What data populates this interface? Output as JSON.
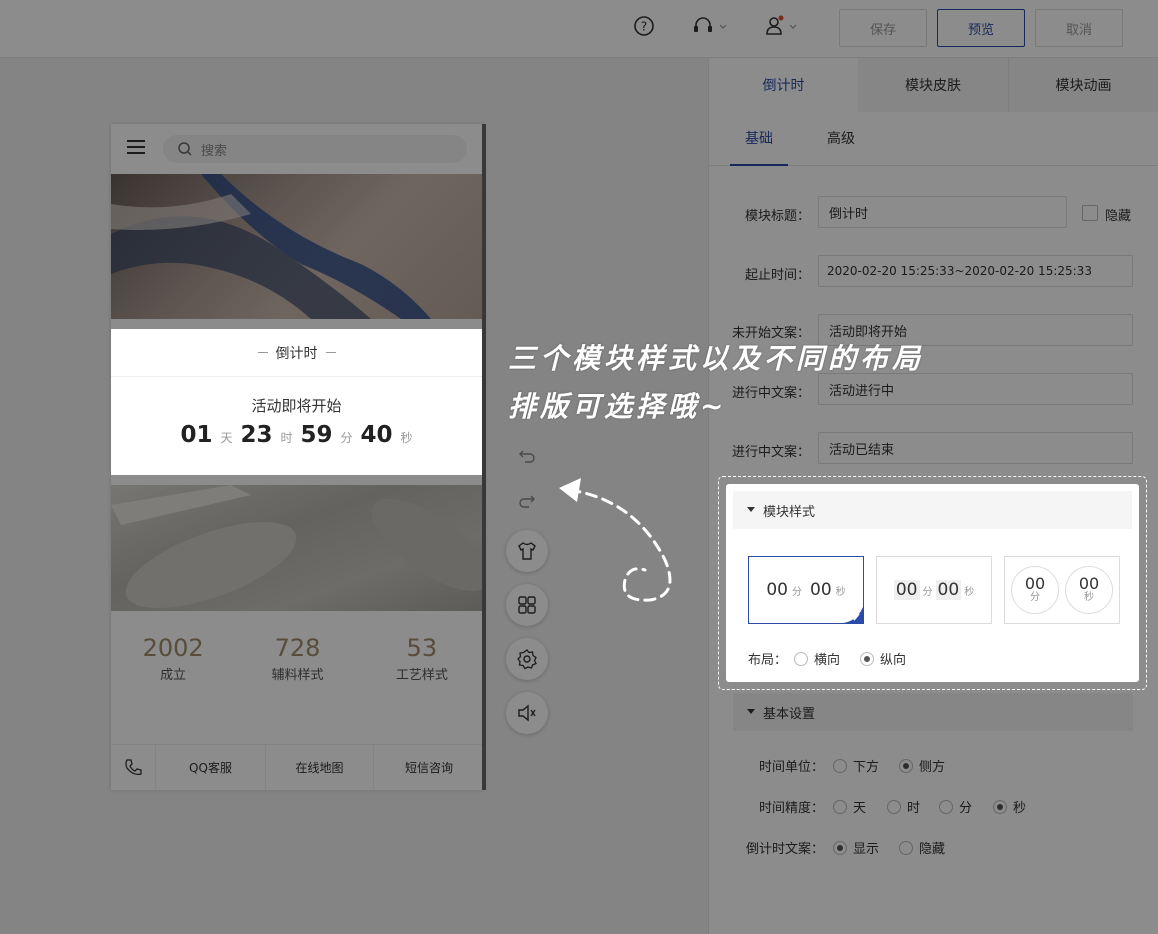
{
  "toolbar": {
    "help_icon": "question-circle-icon",
    "service_icon": "headset-icon",
    "user_icon": "user-icon",
    "save_label": "保存",
    "preview_label": "预览",
    "cancel_label": "取消"
  },
  "phone": {
    "search_placeholder": "搜索",
    "countdown": {
      "title": "倒计时",
      "status_text": "活动即将开始",
      "days": "01",
      "days_unit": "天",
      "hours": "23",
      "hours_unit": "时",
      "minutes": "59",
      "minutes_unit": "分",
      "seconds": "40",
      "seconds_unit": "秒"
    },
    "stats": [
      {
        "value": "2002",
        "label": "成立"
      },
      {
        "value": "728",
        "label": "辅料样式"
      },
      {
        "value": "53",
        "label": "工艺样式"
      }
    ],
    "footer": [
      "QQ客服",
      "在线地图",
      "短信咨询"
    ]
  },
  "panel": {
    "tabs": [
      "倒计时",
      "模块皮肤",
      "模块动画"
    ],
    "subtabs": [
      "基础",
      "高级"
    ],
    "module_title_label": "模块标题：",
    "module_title_value": "倒计时",
    "hide_label": "隐藏",
    "time_range_label": "起止时间：",
    "time_range_value": "2020-02-20 15:25:33~2020-02-20 15:25:33",
    "not_started_label": "未开始文案：",
    "not_started_value": "活动即将开始",
    "in_progress_label": "进行中文案：",
    "in_progress_value": "活动进行中",
    "ended_label": "进行中文案：",
    "ended_value": "活动已结束",
    "module_style_title": "模块样式",
    "style_samples": {
      "s1_min": "00",
      "s1_min_unit": "分",
      "s1_sec": "00",
      "s1_sec_unit": "秒",
      "s2_min": "00",
      "s2_min_unit": "分",
      "s2_sec": "00",
      "s2_sec_unit": "秒",
      "s3_min": "00",
      "s3_min_unit": "分",
      "s3_sec": "00",
      "s3_sec_unit": "秒"
    },
    "layout_label": "布局：",
    "layout_options": [
      "横向",
      "纵向"
    ],
    "basic_settings_title": "基本设置",
    "time_unit_label": "时间单位：",
    "time_unit_options": [
      "下方",
      "侧方"
    ],
    "precision_label": "时间精度：",
    "precision_options": [
      "天",
      "时",
      "分",
      "秒"
    ],
    "countdown_text_label": "倒计时文案：",
    "countdown_text_options": [
      "显示",
      "隐藏"
    ]
  },
  "annotation": {
    "line1": "三个模块样式以及不同的布局",
    "line2": "排版可选择哦~"
  },
  "colors": {
    "accent": "#2a4ba8",
    "stat": "#a08a6a"
  }
}
